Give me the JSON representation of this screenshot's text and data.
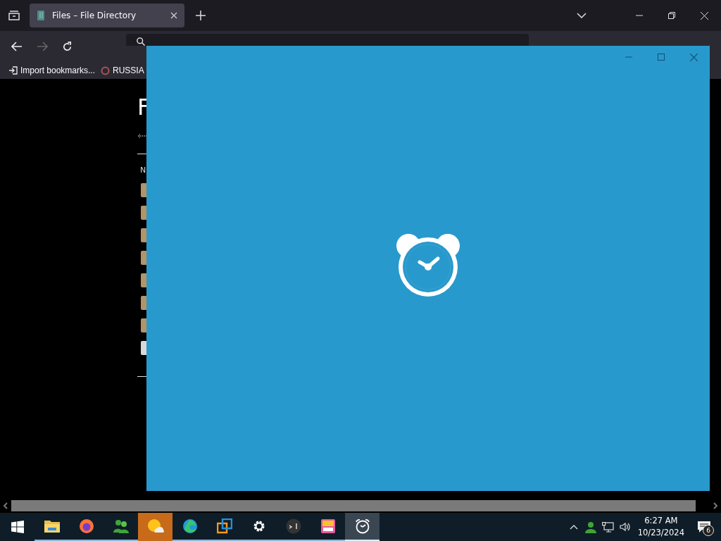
{
  "browser": {
    "tabs": [
      {
        "title": "Files – File Directory",
        "selected": true
      }
    ],
    "bookmarks": [
      {
        "label": "Import bookmarks..."
      },
      {
        "label": "RUSSIA"
      }
    ]
  },
  "page": {
    "heading": "F",
    "column_header": "N",
    "rows": [
      {
        "kind": "folder"
      },
      {
        "kind": "folder"
      },
      {
        "kind": "folder"
      },
      {
        "kind": "folder"
      },
      {
        "kind": "folder"
      },
      {
        "kind": "folder"
      },
      {
        "kind": "folder"
      },
      {
        "kind": "file"
      }
    ]
  },
  "taskbar": {
    "apps": [
      {
        "kind": "explorer",
        "selected": false,
        "flashing": false
      },
      {
        "kind": "firefox",
        "selected": false,
        "flashing": false
      },
      {
        "kind": "people",
        "selected": false,
        "flashing": false
      },
      {
        "kind": "weather",
        "selected": false,
        "flashing": true
      },
      {
        "kind": "edge",
        "selected": false,
        "flashing": false
      },
      {
        "kind": "vm",
        "selected": false,
        "flashing": false
      },
      {
        "kind": "settings",
        "selected": false,
        "flashing": false
      },
      {
        "kind": "terminal",
        "selected": false,
        "flashing": false
      },
      {
        "kind": "game",
        "selected": false,
        "flashing": false
      },
      {
        "kind": "alarm",
        "selected": true,
        "flashing": false
      }
    ],
    "tray": {
      "time": "6:27 AM",
      "date": "10/23/2024",
      "notifications": "6"
    }
  }
}
